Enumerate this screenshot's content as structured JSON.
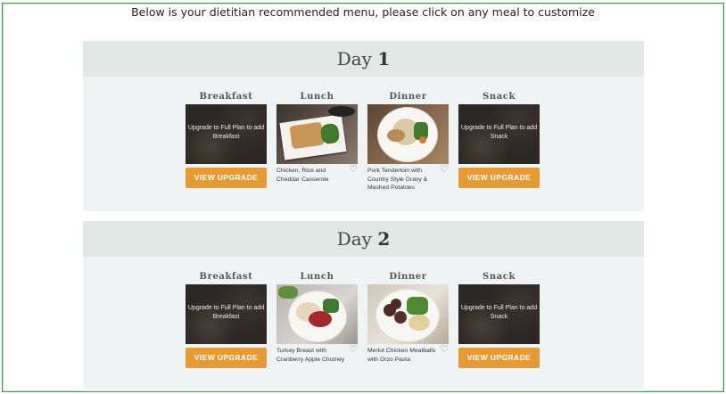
{
  "intro_text": "Below is your dietitian recommended menu, please click on any meal to customize",
  "days": [
    {
      "prefix": "Day",
      "number": "1",
      "meals": [
        {
          "label": "Breakfast",
          "locked": true,
          "locked_text": "Upgrade to Full Plan to add Breakfast",
          "button": "VIEW UPGRADE"
        },
        {
          "label": "Lunch",
          "locked": false,
          "name": "Chicken, Rice and Cheddar Casserole"
        },
        {
          "label": "Dinner",
          "locked": false,
          "name": "Pork Tenderloin with Country Style Gravy & Mashed Potatoes"
        },
        {
          "label": "Snack",
          "locked": true,
          "locked_text": "Upgrade to Full Plan to add Snack",
          "button": "VIEW UPGRADE"
        }
      ]
    },
    {
      "prefix": "Day",
      "number": "2",
      "meals": [
        {
          "label": "Breakfast",
          "locked": true,
          "locked_text": "Upgrade to Full Plan to add Breakfast",
          "button": "VIEW UPGRADE"
        },
        {
          "label": "Lunch",
          "locked": false,
          "name": "Turkey Breast with Cranberry Apple Chutney"
        },
        {
          "label": "Dinner",
          "locked": false,
          "name": "Merlot Chicken Meatballs with Orzo Pasta"
        },
        {
          "label": "Snack",
          "locked": true,
          "locked_text": "Upgrade to Full Plan to add Snack",
          "button": "VIEW UPGRADE"
        }
      ]
    }
  ],
  "icons": {
    "favorite": "heart-outline-icon"
  },
  "colors": {
    "accent": "#e59a33",
    "day_header_bg": "#e1e8e6",
    "day_body_bg": "#eff3f3",
    "frame_border": "#3f9a4a"
  }
}
